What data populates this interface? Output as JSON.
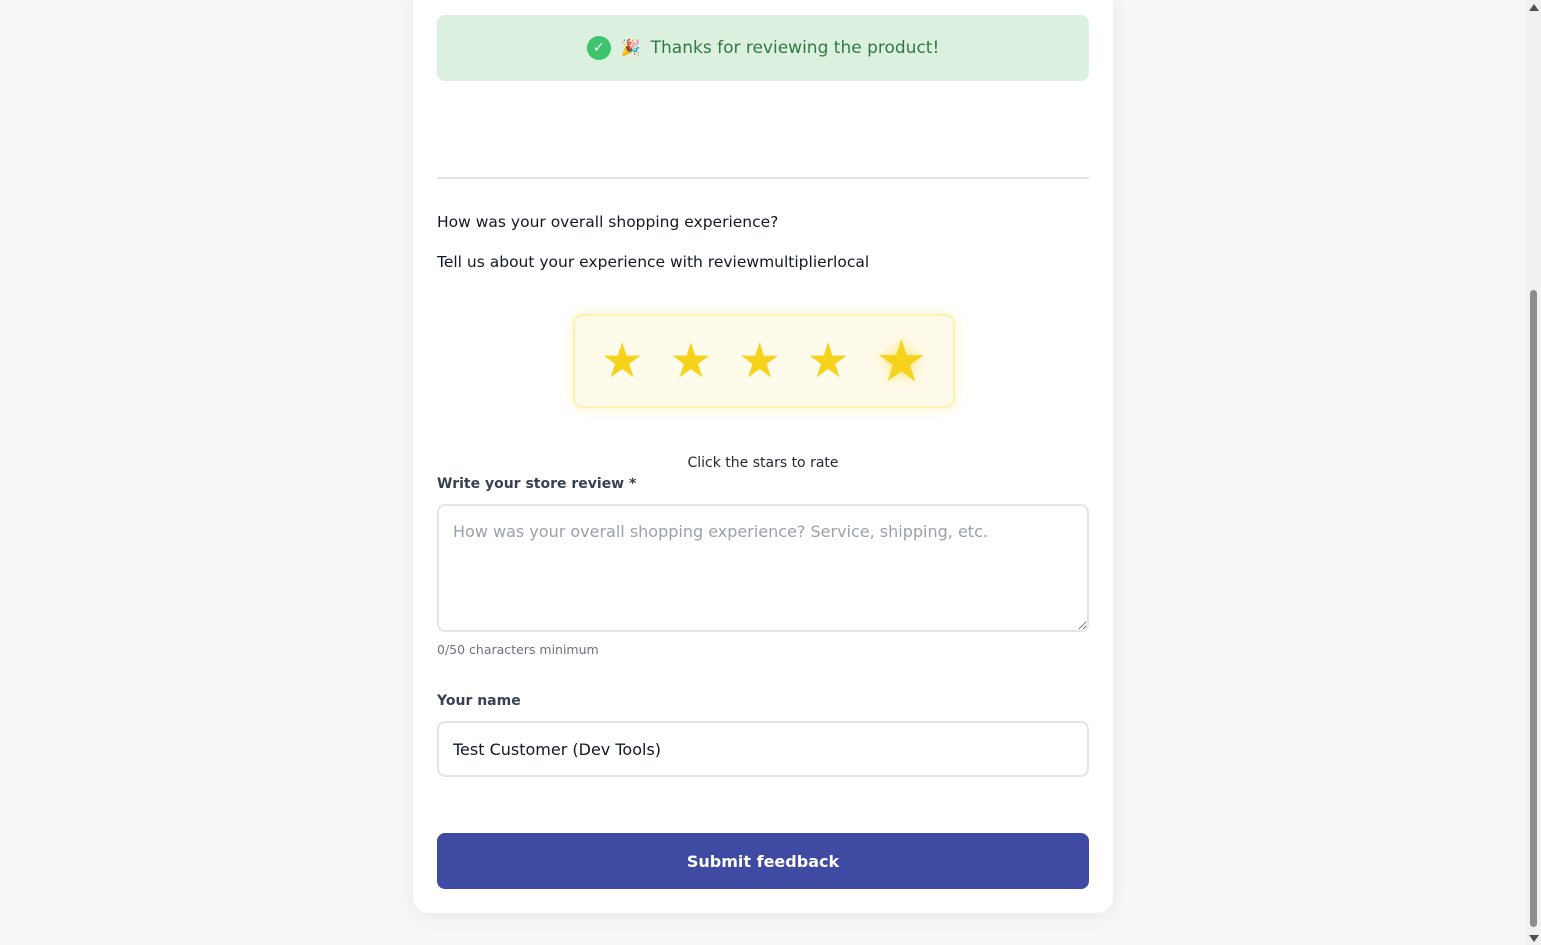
{
  "banner": {
    "check_icon": "✓",
    "party_icon": "🎉",
    "message": "Thanks for reviewing the product!"
  },
  "store_review": {
    "question": "How was your overall shopping experience?",
    "subtitle": "Tell us about your experience with reviewmultiplierlocal",
    "rating": {
      "value": 5,
      "max": 5,
      "star_glyph": "★",
      "star_color": "#f7d21b"
    },
    "hint": "Click the stars to rate",
    "review_label": "Write your store review *",
    "review_value": "",
    "review_placeholder": "How was your overall shopping experience? Service, shipping, etc.",
    "counter": "0/50 characters minimum",
    "name_label": "Your name",
    "name_value": "Test Customer (Dev Tools)",
    "submit_label": "Submit feedback"
  },
  "colors": {
    "accent": "#3f4aa3",
    "success_bg": "#dcf0e0",
    "success_text": "#2f7a46",
    "star": "#f7d21b"
  }
}
